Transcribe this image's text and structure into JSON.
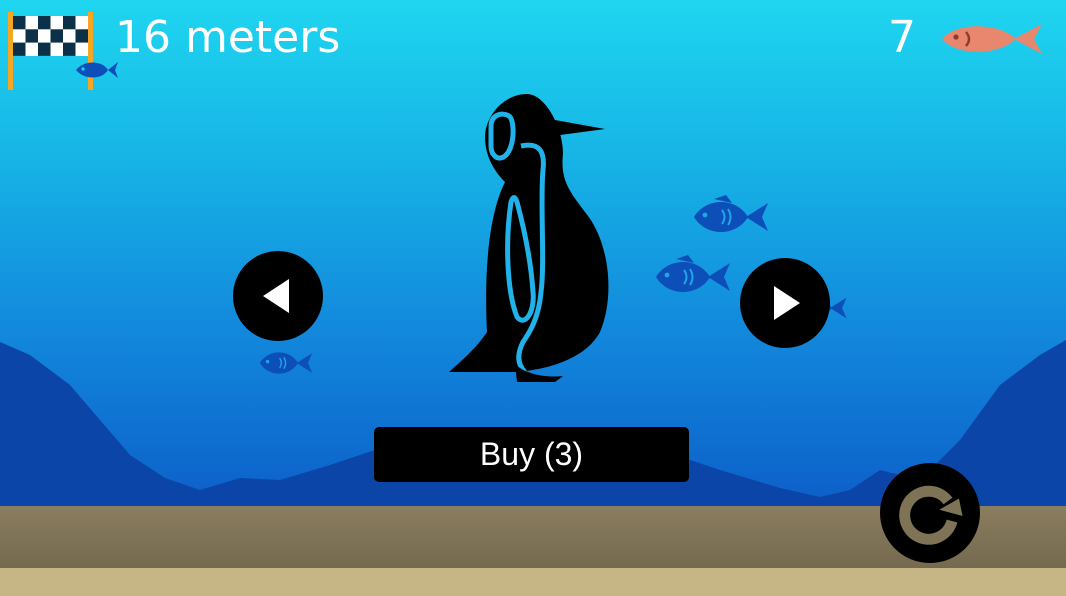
{
  "hud": {
    "distance_label": "16 meters",
    "fish_count": "7",
    "goal_icon": "checkered-flag-icon",
    "fish_icon": "fish-icon"
  },
  "shop": {
    "character": "penguin",
    "buy_label": "Buy (3)",
    "prev_icon": "arrow-left-icon",
    "next_icon": "arrow-right-icon",
    "replay_icon": "replay-icon"
  },
  "colors": {
    "sky_top": "#1fd6f0",
    "water_deep": "#0b52c0",
    "hills": "#0b45a8",
    "ground": "#7f7357",
    "sand": "#c6b585",
    "decor_fish": "#0d4fb8",
    "hud_fish": "#e8876e",
    "penguin_accent": "#22b2ea",
    "button": "#000000",
    "replay_arrow": "#7e7354"
  }
}
